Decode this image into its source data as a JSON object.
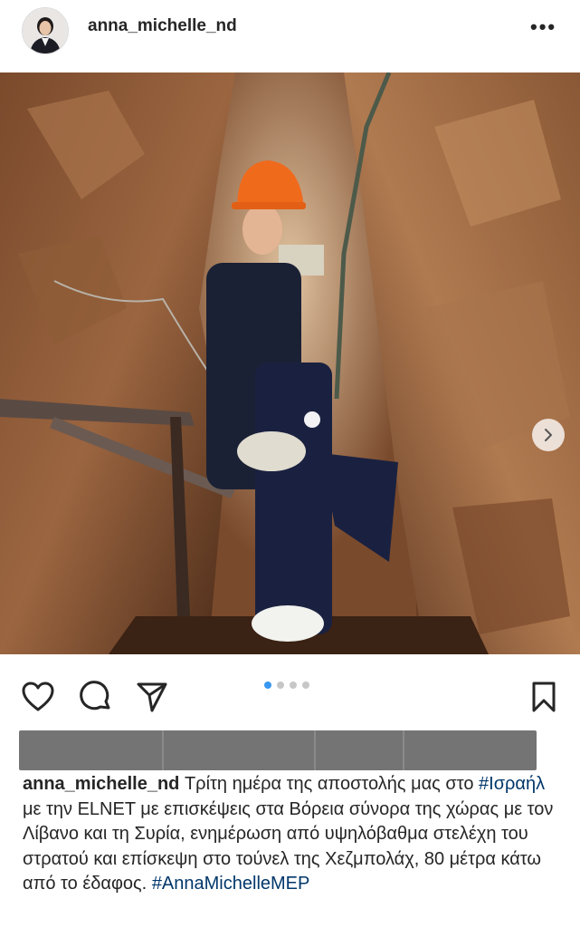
{
  "post": {
    "username": "anna_michelle_nd",
    "more_icon": "more-horizontal-icon"
  },
  "carousel": {
    "total": 4,
    "active_index": 0
  },
  "actions": {
    "like_icon": "heart-icon",
    "comment_icon": "comment-icon",
    "share_icon": "share-icon",
    "save_icon": "bookmark-icon"
  },
  "caption": {
    "username": "anna_michelle_nd",
    "text_1": "Τρίτη ημέρα της αποστολής μας στο",
    "hashtag_1": "#Ισραήλ",
    "text_2": "με την ELNET με επισκέψεις στα Βόρεια σύνορα της χώρας με τον Λίβανο και τη Συρία, ενημέρωση από υψηλόβαθμα στελέχη του στρατού και επίσκεψη στο τούνελ της Χεζμπολάχ, 80 μέτρα κάτω από το έδαφος.",
    "hashtag_2": "#AnnaMichelleMEP"
  },
  "colors": {
    "text": "#262626",
    "hashtag": "#00376b",
    "dot_active": "#3897f0",
    "dot_inactive": "#c7c7c7",
    "redaction": "#747474"
  }
}
